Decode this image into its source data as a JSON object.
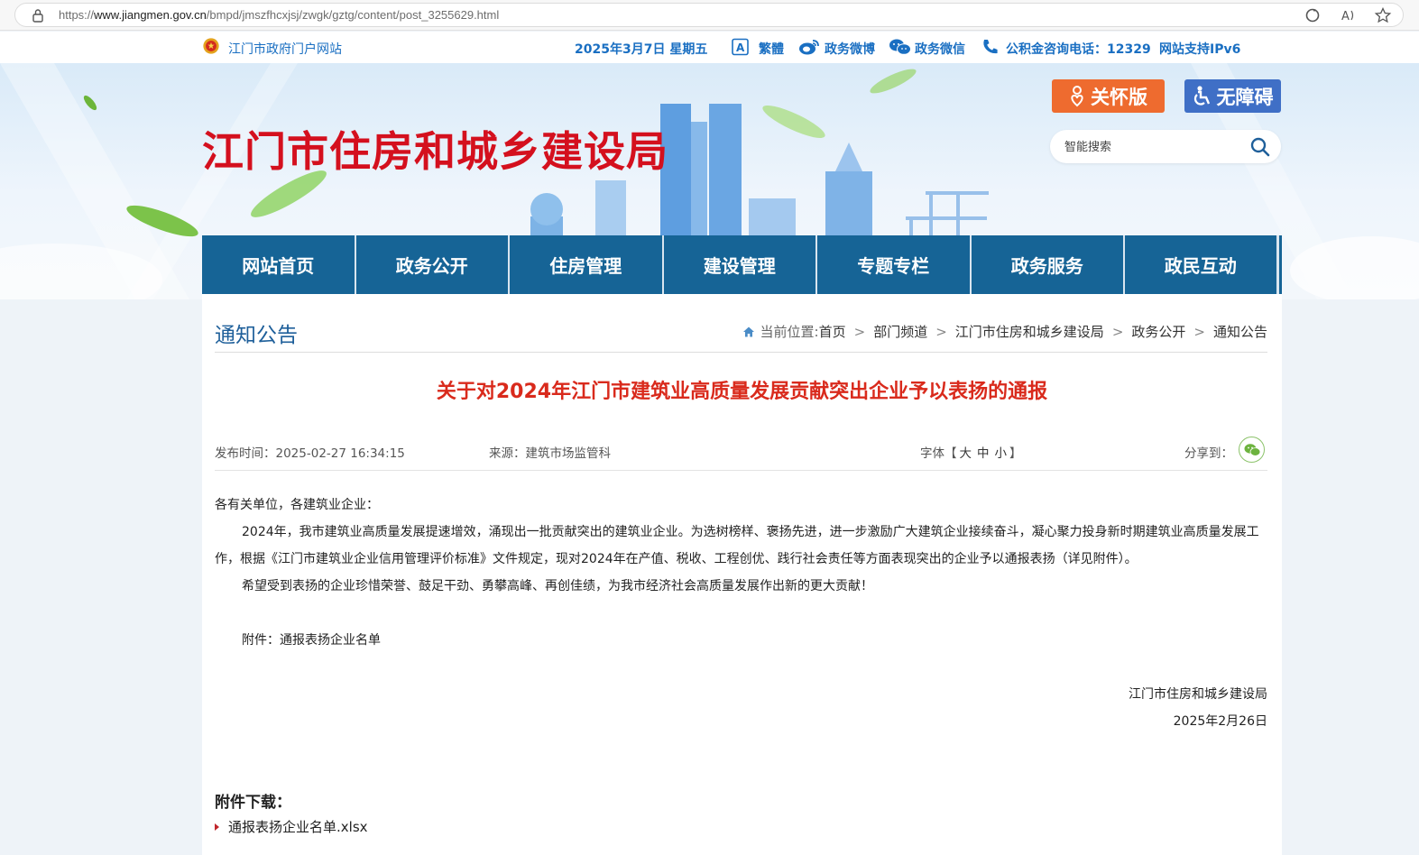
{
  "browser": {
    "url_prefix": "https://",
    "url_host": "www.jiangmen.gov.cn",
    "url_path": "/bmpd/jmszfhcxjsj/zwgk/gztg/content/post_3255629.html"
  },
  "topstrip": {
    "portal": "江门市政府门户网站",
    "date": "2025年3月7日 星期五",
    "traditional": "繁體",
    "weibo": "政务微博",
    "wechat": "政务微信",
    "hotline": "公积金咨询电话：12329",
    "ipv6": "网站支持IPv6"
  },
  "banner": {
    "site_title": "江门市住房和城乡建设局",
    "care_label": "关怀版",
    "access_label": "无障碍",
    "search_placeholder": "智能搜索"
  },
  "nav": {
    "items": [
      "网站首页",
      "政务公开",
      "住房管理",
      "建设管理",
      "专题专栏",
      "政务服务",
      "政民互动"
    ]
  },
  "section": {
    "title": "通知公告",
    "crumb_prefix": "当前位置:",
    "crumbs": [
      "首页",
      "部门频道",
      "江门市住房和城乡建设局",
      "政务公开",
      "通知公告"
    ],
    "separator": ">"
  },
  "article": {
    "title": "关于对2024年江门市建筑业高质量发展贡献突出企业予以表扬的通报",
    "publish_time": "发布时间：2025-02-27 16:34:15",
    "source": "来源：建筑市场监管科",
    "font_label": "字体【",
    "font_large": "大",
    "font_medium": "中",
    "font_small": "小",
    "font_close": "】",
    "share_label": "分享到：",
    "salutation": "各有关单位，各建筑业企业：",
    "para1": "2024年，我市建筑业高质量发展提速增效，涌现出一批贡献突出的建筑业企业。为选树榜样、褒扬先进，进一步激励广大建筑企业接续奋斗，凝心聚力投身新时期建筑业高质量发展工作，根据《江门市建筑业企业信用管理评价标准》文件规定，现对2024年在产值、税收、工程创优、践行社会责任等方面表现突出的企业予以通报表扬（详见附件）。",
    "para2": "希望受到表扬的企业珍惜荣誉、鼓足干劲、勇攀高峰、再创佳绩，为我市经济社会高质量发展作出新的更大贡献！",
    "attachment_note": "附件：通报表扬企业名单",
    "signature": "江门市住房和城乡建设局",
    "sign_date": "2025年2月26日"
  },
  "attachments": {
    "heading": "附件下载：",
    "files": [
      "通报表扬企业名单.xlsx"
    ]
  },
  "colors": {
    "title_red": "#d4101e",
    "nav_blue": "#166496",
    "link_blue": "#1a6fc2",
    "care_orange": "#ee6b2f",
    "access_blue": "#3f6fc6"
  }
}
